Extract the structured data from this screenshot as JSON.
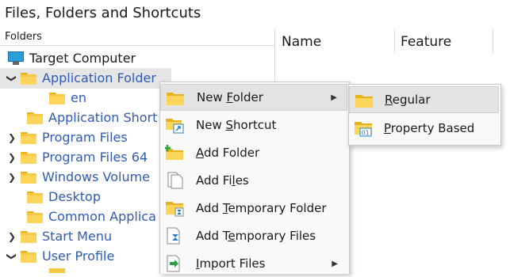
{
  "title": "Files, Folders and Shortcuts",
  "tree": {
    "header": "Folders",
    "items": [
      {
        "label": "Target Computer",
        "chevron": ""
      },
      {
        "label": "Application Folder",
        "chevron": "❯"
      },
      {
        "label": "en",
        "chevron": ""
      },
      {
        "label": "Application Short",
        "chevron": ""
      },
      {
        "label": "Program Files",
        "chevron": "❯"
      },
      {
        "label": "Program Files 64",
        "chevron": "❯"
      },
      {
        "label": "Windows Volume",
        "chevron": "❯"
      },
      {
        "label": "Desktop",
        "chevron": ""
      },
      {
        "label": "Common Applica",
        "chevron": ""
      },
      {
        "label": "Start Menu",
        "chevron": "❯"
      },
      {
        "label": "User Profile",
        "chevron": "❯"
      }
    ]
  },
  "list": {
    "columns": [
      "Name",
      "Feature"
    ]
  },
  "context_menu": {
    "items": [
      {
        "pre": "New ",
        "key": "F",
        "post": "older",
        "has_submenu": true,
        "icon": "folder-icon"
      },
      {
        "pre": "New ",
        "key": "S",
        "post": "hortcut",
        "has_submenu": false,
        "icon": "shortcut-icon"
      },
      {
        "pre": "",
        "key": "A",
        "post": "dd Folder",
        "has_submenu": false,
        "icon": "add-folder-icon"
      },
      {
        "pre": "Add Fi",
        "key": "l",
        "post": "es",
        "has_submenu": false,
        "icon": "add-files-icon"
      },
      {
        "pre": "Add ",
        "key": "T",
        "post": "emporary Folder",
        "has_submenu": false,
        "icon": "temporary-folder-icon"
      },
      {
        "pre": "Add T",
        "key": "e",
        "post": "mporary Files",
        "has_submenu": false,
        "icon": "temporary-files-icon"
      },
      {
        "pre": "",
        "key": "I",
        "post": "mport Files",
        "has_submenu": true,
        "icon": "import-files-icon"
      }
    ],
    "arrow": "▶"
  },
  "submenu": {
    "items": [
      {
        "pre": "",
        "key": "R",
        "post": "egular",
        "icon": "folder-icon"
      },
      {
        "pre": "",
        "key": "P",
        "post": "roperty Based",
        "icon": "property-folder-icon"
      }
    ]
  },
  "icon_badge": "01"
}
